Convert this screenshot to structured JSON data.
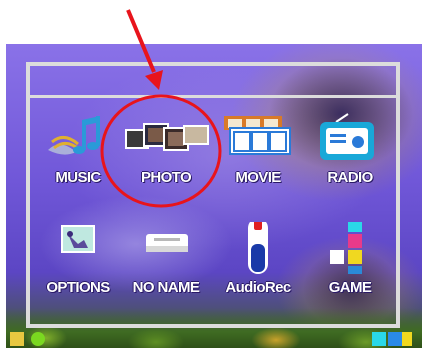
{
  "menu": {
    "items": [
      {
        "label": "MUSIC",
        "icon": "music-note-icon"
      },
      {
        "label": "PHOTO",
        "icon": "photo-icon"
      },
      {
        "label": "MOVIE",
        "icon": "movie-icon"
      },
      {
        "label": "RADIO",
        "icon": "radio-icon"
      },
      {
        "label": "OPTIONS",
        "icon": "options-icon"
      },
      {
        "label": "NO NAME",
        "icon": "folder-icon"
      },
      {
        "label": "AudioRec",
        "icon": "mic-icon"
      },
      {
        "label": "GAME",
        "icon": "game-icon"
      }
    ],
    "selected": "PHOTO"
  },
  "annotation": {
    "color": "#e8141c",
    "target": "PHOTO"
  }
}
